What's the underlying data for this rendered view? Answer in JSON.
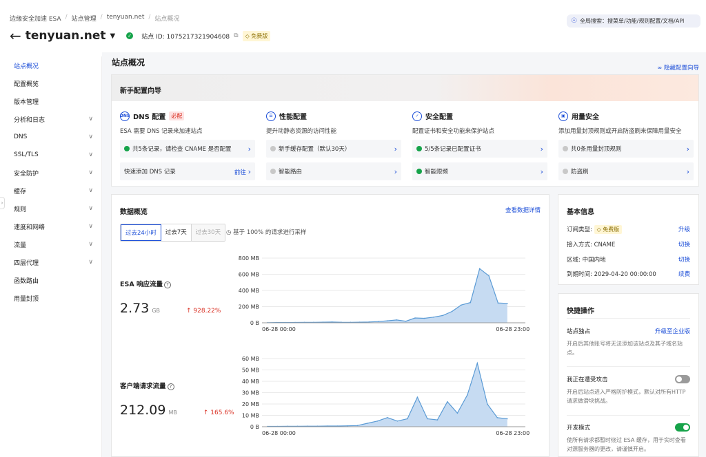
{
  "breadcrumb": [
    "边缘安全加速 ESA",
    "站点管理",
    "tenyuan.net",
    "站点概况"
  ],
  "global_search": "全局搜索：搜菜单/功能/规则配置/文档/API",
  "site": {
    "domain": "tenyuan.net",
    "site_id_label": "站点 ID: 1075217321904608",
    "plan_badge": "免费版"
  },
  "sidebar": {
    "items": [
      {
        "label": "站点概况",
        "active": true,
        "expandable": false
      },
      {
        "label": "配置概览",
        "active": false,
        "expandable": false
      },
      {
        "label": "版本管理",
        "active": false,
        "expandable": false
      },
      {
        "label": "分析和日志",
        "active": false,
        "expandable": true
      },
      {
        "label": "DNS",
        "active": false,
        "expandable": true
      },
      {
        "label": "SSL/TLS",
        "active": false,
        "expandable": true
      },
      {
        "label": "安全防护",
        "active": false,
        "expandable": true
      },
      {
        "label": "缓存",
        "active": false,
        "expandable": true
      },
      {
        "label": "规则",
        "active": false,
        "expandable": true
      },
      {
        "label": "速度和网络",
        "active": false,
        "expandable": true
      },
      {
        "label": "流量",
        "active": false,
        "expandable": true
      },
      {
        "label": "四层代理",
        "active": false,
        "expandable": true
      },
      {
        "label": "函数路由",
        "active": false,
        "expandable": false
      },
      {
        "label": "用量封顶",
        "active": false,
        "expandable": false
      }
    ]
  },
  "page": {
    "title": "站点概况",
    "hide_guide": "隐藏配置向导"
  },
  "guide": {
    "title": "新手配置向导",
    "columns": [
      {
        "title": "DNS 配置",
        "tag": "必配",
        "icon": "dns-icon",
        "desc": "ESA 需要 DNS 记录来加速站点",
        "rows": [
          {
            "text": "共5条记录，请检查 CNAME 是否配置",
            "status": "ok",
            "action": ""
          },
          {
            "text": "快速添加 DNS 记录",
            "status": "none",
            "action": "前往"
          }
        ]
      },
      {
        "title": "性能配置",
        "tag": "",
        "icon": "document-icon",
        "desc": "提升动静态资源的访问性能",
        "rows": [
          {
            "text": "新手缓存配置（默认30天）",
            "status": "grey",
            "action": ""
          },
          {
            "text": "智能路由",
            "status": "grey",
            "action": ""
          }
        ]
      },
      {
        "title": "安全配置",
        "tag": "",
        "icon": "shield-icon",
        "desc": "配置证书和安全功能来保护站点",
        "rows": [
          {
            "text": "5/5条记录已配置证书",
            "status": "ok",
            "action": ""
          },
          {
            "text": "智能限频",
            "status": "ok",
            "action": ""
          }
        ]
      },
      {
        "title": "用量安全",
        "tag": "",
        "icon": "monitor-icon",
        "desc": "添加用量封顶规则或开启防盗刷来保障用量安全",
        "rows": [
          {
            "text": "共0条用量封顶规则",
            "status": "grey",
            "action": ""
          },
          {
            "text": "防盗刷",
            "status": "grey",
            "action": ""
          }
        ]
      }
    ]
  },
  "overview": {
    "title": "数据概览",
    "detail_link": "查看数据详情",
    "ranges": [
      "过去24小时",
      "过去7天",
      "过去30天"
    ],
    "sample_note": "基于 100% 的请求进行采样",
    "metrics": [
      {
        "name": "ESA 响应流量",
        "value": "2.73",
        "unit": "GB",
        "delta": "↑ 928.22%"
      },
      {
        "name": "客户端请求流量",
        "value": "212.09",
        "unit": "MB",
        "delta": "↑ 165.6%"
      }
    ]
  },
  "chart_data": [
    {
      "type": "area",
      "title": "ESA 响应流量",
      "unit": "MB",
      "x_start": "06-28 00:00",
      "x_end": "06-28 23:00",
      "yticks": [
        "800 MB",
        "600 MB",
        "400 MB",
        "200 MB",
        "0 B"
      ],
      "ylim": [
        0,
        800
      ],
      "values": [
        2,
        3,
        3,
        4,
        5,
        6,
        8,
        10,
        7,
        6,
        8,
        10,
        15,
        25,
        35,
        20,
        60,
        55,
        70,
        90,
        140,
        220,
        250,
        670,
        580,
        245,
        240
      ]
    },
    {
      "type": "area",
      "title": "客户端请求流量",
      "unit": "MB",
      "x_start": "06-28 00:00",
      "x_end": "06-28 23:00",
      "yticks": [
        "60 MB",
        "50 MB",
        "40 MB",
        "30 MB",
        "20 MB",
        "10 MB",
        "0 B"
      ],
      "ylim": [
        0,
        60
      ],
      "values": [
        0.3,
        0.3,
        0.4,
        0.4,
        0.5,
        0.5,
        0.6,
        0.6,
        0.8,
        1,
        3,
        5,
        8,
        5,
        7,
        26,
        7,
        6,
        22,
        12,
        28,
        56,
        20,
        8,
        7
      ]
    }
  ],
  "basic_info": {
    "title": "基本信息",
    "rows": [
      {
        "label": "订阅类型:",
        "value": "免费版",
        "action": "升级"
      },
      {
        "label": "接入方式: CNAME",
        "value": "",
        "action": "切换"
      },
      {
        "label": "区域: 中国内地",
        "value": "",
        "action": "切换"
      },
      {
        "label": "到期时间: 2029-04-20 00:00:00",
        "value": "",
        "action": "续费"
      }
    ]
  },
  "quick_ops": {
    "title": "快捷操作",
    "items": [
      {
        "title": "站点独占",
        "action": "升级至企业版",
        "desc": "开启后其他账号将无法添加该站点及其子域名站点。",
        "toggle": ""
      },
      {
        "title": "我正在遭受攻击",
        "action": "",
        "desc": "开启后站点进入严格防护模式，默认对所有HTTP 请求做滑块挑战。",
        "toggle": "off"
      },
      {
        "title": "开发模式",
        "action": "",
        "desc": "使所有请求都暂时绕过 ESA 缓存，用于实时查看对源服务器的更改，请谨慎开启。",
        "toggle": "on"
      }
    ]
  },
  "colors": {
    "accent": "#1d4fd8",
    "success": "#16a34a",
    "danger": "#d92d20",
    "chart_fill": "#c6dbf2",
    "chart_line": "#5b9bd5"
  }
}
